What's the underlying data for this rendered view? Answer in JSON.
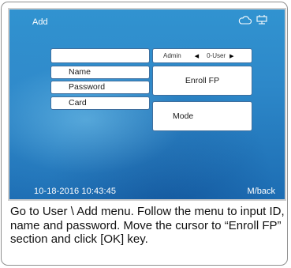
{
  "screen": {
    "title": "Add",
    "status_icons": [
      "cloud-icon",
      "network-icon"
    ],
    "fields": {
      "id_value": "",
      "name_label": "Name",
      "password_label": "Password",
      "card_label": "Card"
    },
    "role_selector": {
      "left": "Admin",
      "right": "0-User",
      "left_arrow": "◀",
      "right_arrow": "▶"
    },
    "enroll_fp_label": "Enroll FP",
    "mode_label": "Mode",
    "datetime": "10-18-2016 10:43:45",
    "back_label": "M/back"
  },
  "caption": "Go to User \\ Add menu. Follow the menu to input ID, name and password. Move the cursor to “Enroll FP” section and click [OK] key.",
  "colors": {
    "screen_blue": "#2d88c9",
    "box_border": "#3f6f9e",
    "text_white": "#ffffff"
  }
}
